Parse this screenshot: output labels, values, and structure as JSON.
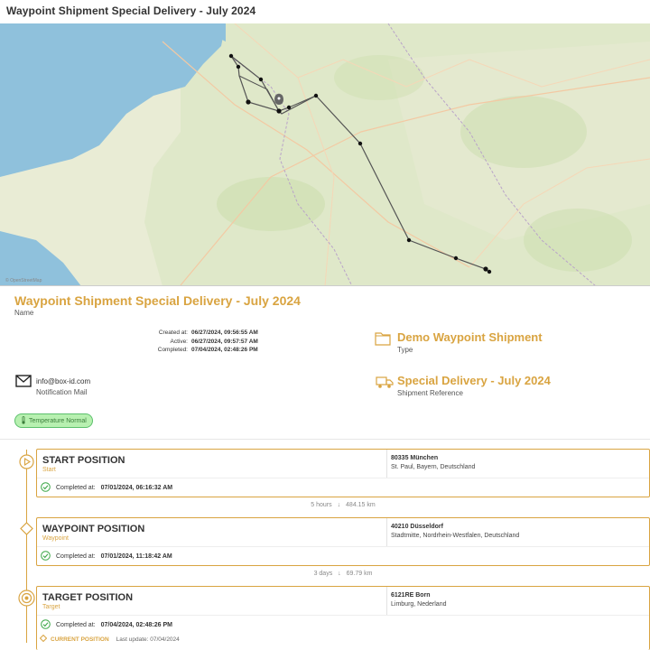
{
  "page": {
    "title": "Waypoint Shipment Special Delivery - July 2024"
  },
  "header": {
    "title": "Waypoint Shipment Special Delivery - July 2024",
    "name_label": "Name"
  },
  "dates": [
    {
      "key": "Created at:",
      "value": "06/27/2024, 09:56:55 AM"
    },
    {
      "key": "Active:",
      "value": "06/27/2024, 09:57:57 AM"
    },
    {
      "key": "Completed:",
      "value": "07/04/2024, 02:48:26 PM"
    }
  ],
  "type_info": {
    "value": "Demo Waypoint Shipment",
    "label": "Type"
  },
  "reference_info": {
    "value": "Special Delivery - July 2024",
    "label": "Shipment Reference"
  },
  "notification": {
    "email": "info@box-id.com",
    "label": "Notification Mail"
  },
  "badge": {
    "label": "Temperature Normal"
  },
  "stops": [
    {
      "name": "START POSITION",
      "type": "Start",
      "addr1": "80335 München",
      "addr2": "St. Paul, Bayern, Deutschland",
      "completed_label": "Completed at:",
      "completed_value": "07/01/2024, 06:16:32 AM"
    },
    {
      "name": "WAYPOINT POSITION",
      "type": "Waypoint",
      "addr1": "40210 Düsseldorf",
      "addr2": "Stadtmitte, Nordrhein-Westfalen, Deutschland",
      "completed_label": "Completed at:",
      "completed_value": "07/01/2024, 11:18:42 AM"
    },
    {
      "name": "TARGET POSITION",
      "type": "Target",
      "addr1": "6121RE Born",
      "addr2": "Limburg, Nederland",
      "completed_label": "Completed at:",
      "completed_value": "07/04/2024, 02:48:26 PM"
    }
  ],
  "legs": [
    {
      "duration": "5 hours",
      "distance": "484.15 km"
    },
    {
      "duration": "3 days",
      "distance": "69.79 km"
    }
  ],
  "current": {
    "label": "CURRENT POSITION",
    "last_update": "Last update: 07/04/2024"
  },
  "colors": {
    "accent": "#d9a441",
    "badge_bg": "#b7f0b0",
    "badge_border": "#5cc06c",
    "sea": "#8fc1dc",
    "land": "#e8ecd6"
  },
  "icons": [
    "flag-icon",
    "folder-icon",
    "truck-icon",
    "mail-icon",
    "thermometer-icon",
    "check-circle-icon",
    "arrow-down-icon",
    "play-icon",
    "diamond-icon",
    "target-icon"
  ]
}
